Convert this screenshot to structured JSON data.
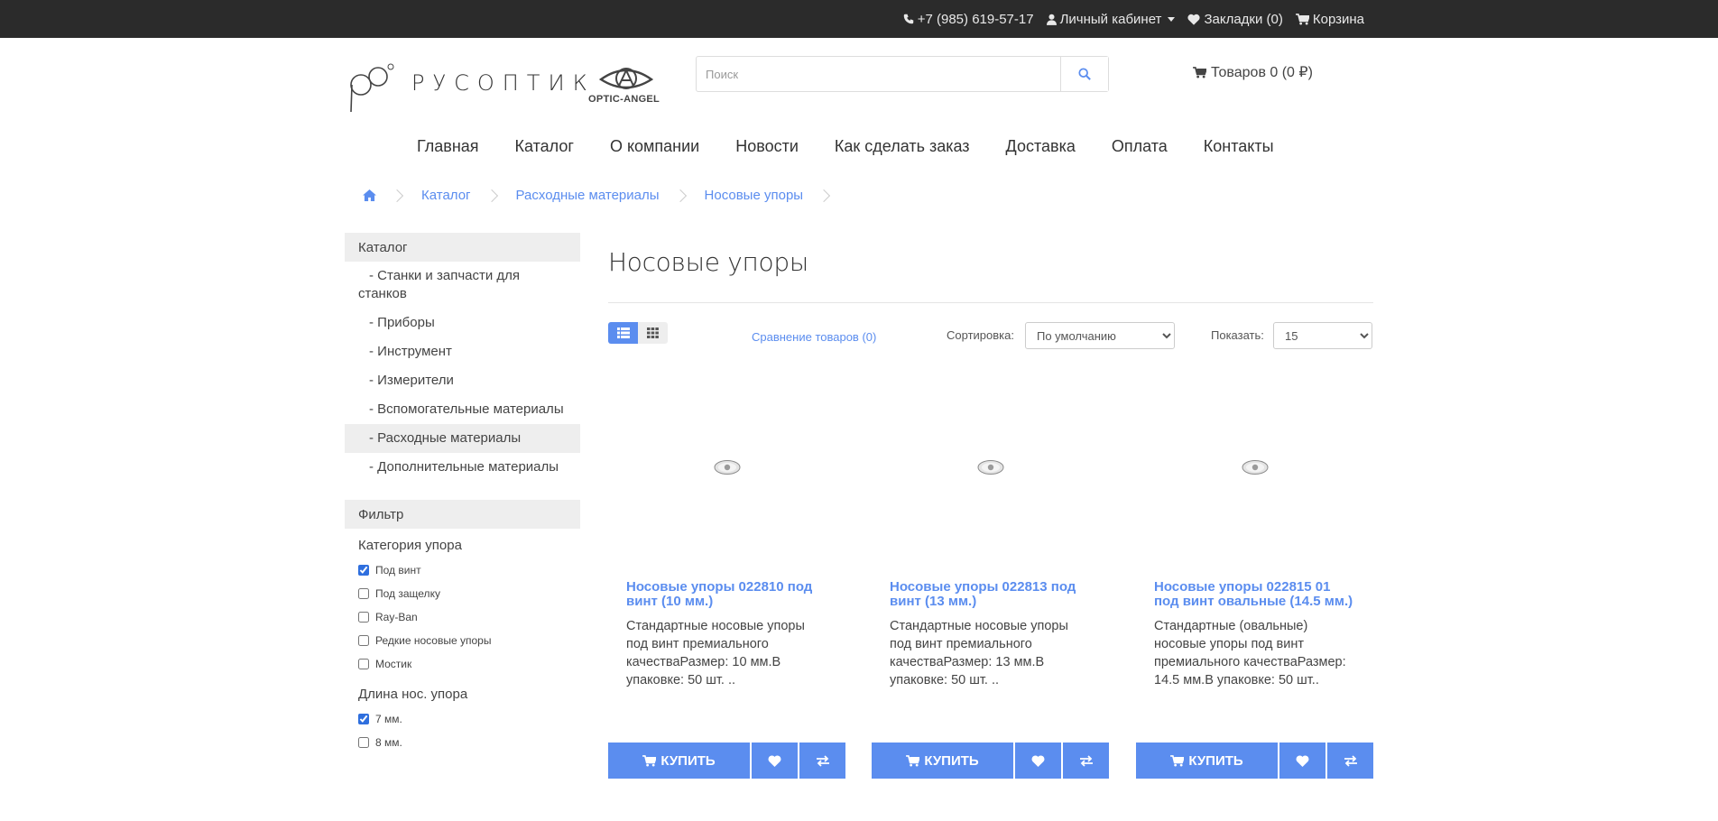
{
  "topbar": {
    "phone": "+7 (985) 619-57-17",
    "account": "Личный кабинет",
    "wishlist": "Закладки (0)",
    "cart": "Корзина"
  },
  "logo": {
    "text": "РУСОПТИК",
    "subtext": "OPTIC-ANGEL"
  },
  "search": {
    "placeholder": "Поиск",
    "value": ""
  },
  "cart_summary": "Товаров 0 (0 ₽)",
  "nav": [
    "Главная",
    "Каталог",
    "О компании",
    "Новости",
    "Как сделать заказ",
    "Доставка",
    "Оплата",
    "Контакты"
  ],
  "breadcrumb": [
    "Каталог",
    "Расходные материалы",
    "Носовые упоры"
  ],
  "sidebar": {
    "title": "Каталог",
    "items": [
      {
        "label": "- Станки и запчасти для станков",
        "active": false
      },
      {
        "label": "- Приборы",
        "active": false
      },
      {
        "label": "- Инструмент",
        "active": false
      },
      {
        "label": "- Измерители",
        "active": false
      },
      {
        "label": "- Вспомогательные материалы",
        "active": false
      },
      {
        "label": "- Расходные материалы",
        "active": true
      },
      {
        "label": "- Дополнительные материалы",
        "active": false
      }
    ]
  },
  "filter": {
    "title": "Фильтр",
    "groups": [
      {
        "title": "Категория упора",
        "options": [
          {
            "label": "Под винт",
            "checked": true
          },
          {
            "label": "Под защелку",
            "checked": false
          },
          {
            "label": "Ray-Ban",
            "checked": false
          },
          {
            "label": "Редкие носовые упоры",
            "checked": false
          },
          {
            "label": "Мостик",
            "checked": false
          }
        ]
      },
      {
        "title": "Длина нос. упора",
        "options": [
          {
            "label": "7 мм.",
            "checked": true
          },
          {
            "label": "8 мм.",
            "checked": false
          }
        ]
      }
    ]
  },
  "page_title": "Носовые упоры",
  "toolbar": {
    "compare": "Сравнение товаров (0)",
    "sort_label": "Сортировка:",
    "sort_value": "По умолчанию",
    "show_label": "Показать:",
    "show_value": "15"
  },
  "products": [
    {
      "name": "Носовые упоры 022810 под винт (10 мм.)",
      "description": "Стандартные носовые упоры под винт премиального качестваРазмер: 10 мм.В упаковке: 50 шт. ..",
      "buy_label": "КУПИТЬ"
    },
    {
      "name": "Носовые упоры 022813 под винт (13 мм.)",
      "description": "Стандартные носовые упоры под винт премиального качестваРазмер: 13 мм.В упаковке: 50 шт. ..",
      "buy_label": "КУПИТЬ"
    },
    {
      "name": "Носовые упоры 022815 01 под винт овальные (14.5 мм.)",
      "description": "Стандартные (овальные) носовые упоры под винт премиального качестваРазмер: 14.5 мм.В упаковке: 50 шт..",
      "buy_label": "КУПИТЬ"
    }
  ],
  "colors": {
    "accent": "#5b8def",
    "topbar": "#2b2b2b",
    "panel": "#eeeeee"
  }
}
